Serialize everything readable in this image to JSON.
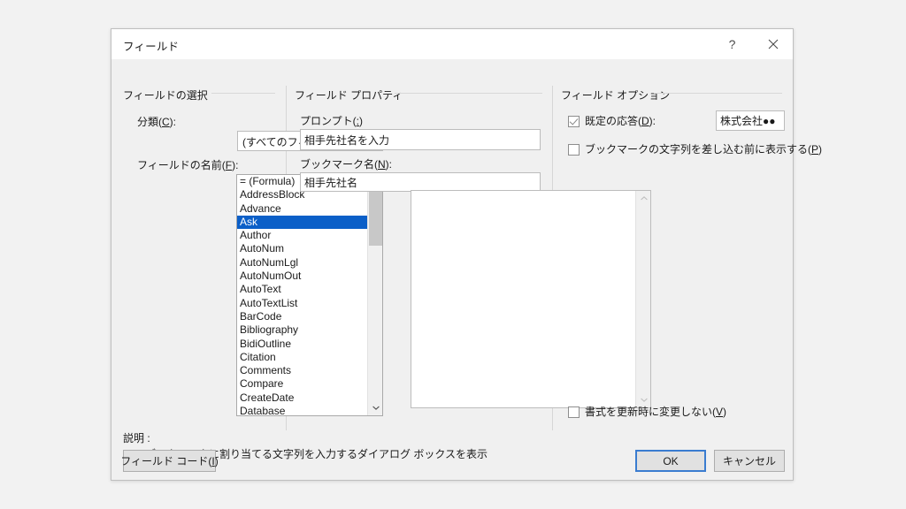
{
  "dialog": {
    "title": "フィールド",
    "titlebar_buttons": {
      "help": "?",
      "close": "✕"
    }
  },
  "left_panel": {
    "group_title": "フィールドの選択",
    "category_label_pre": "分類(",
    "category_label_acc": "C",
    "category_label_post": "):",
    "category_value": "(すべてのフィールド)",
    "category_arrow": "⌄",
    "fieldnames_label_pre": "フィールドの名前(",
    "fieldnames_label_acc": "F",
    "fieldnames_label_post": "):",
    "fieldnames": [
      "= (Formula)",
      "AddressBlock",
      "Advance",
      "Ask",
      "Author",
      "AutoNum",
      "AutoNumLgl",
      "AutoNumOut",
      "AutoText",
      "AutoTextList",
      "BarCode",
      "Bibliography",
      "BidiOutline",
      "Citation",
      "Comments",
      "Compare",
      "CreateDate",
      "Database"
    ],
    "selected_fieldname": "Ask",
    "scroll_up_glyph": "∧",
    "scroll_down_glyph": "∨"
  },
  "middle_panel": {
    "group_title": "フィールド プロパティ",
    "prompt_label_pre": "プロンプト(",
    "prompt_label_acc": ":",
    "prompt_label_post": ")",
    "prompt_value": "相手先社名を入力",
    "bookmark_label_pre": "ブックマーク名(",
    "bookmark_label_acc": "N",
    "bookmark_label_post": "):",
    "bookmark_value": "相手先社名",
    "history_items": [],
    "scroll_up_glyph": "∧",
    "scroll_down_glyph": "∨"
  },
  "right_panel": {
    "group_title": "フィールド オプション",
    "default_answer_label_pre": "既定の応答(",
    "default_answer_label_acc": "D",
    "default_answer_label_post": "):",
    "default_answer_checked": true,
    "default_answer_value": "株式会社●●",
    "show_before_label_pre": "ブックマークの文字列を差し込む前に表示する(",
    "show_before_label_acc": "P",
    "show_before_label_post": ")",
    "show_before_checked": false,
    "preserve_format_label_pre": "書式を更新時に変更しない(",
    "preserve_format_label_acc": "V",
    "preserve_format_label_post": ")",
    "preserve_format_checked": false
  },
  "description": {
    "label": "説明 :",
    "text": "ブックマークに割り当てる文字列を入力するダイアログ ボックスを表示"
  },
  "buttons": {
    "field_code_pre": "フィールド コード(",
    "field_code_acc": "I",
    "field_code_post": ")",
    "ok": "OK",
    "cancel": "キャンセル"
  }
}
